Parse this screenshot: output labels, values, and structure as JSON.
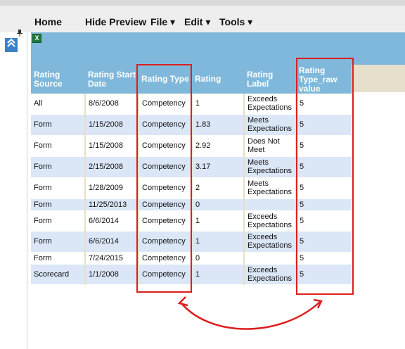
{
  "menubar": {
    "home": "Home",
    "hide_preview": "Hide Preview",
    "file": "File ▾",
    "edit": "Edit ▾",
    "tools": "Tools ▾"
  },
  "icons": {
    "collapse": "double-chevron-up-icon",
    "pin": "pin-icon",
    "excel": "excel-icon"
  },
  "colors": {
    "header_bg": "#7fb8da",
    "row_alt": "#dbe7f7",
    "annotation": "#dd1f1f"
  },
  "table": {
    "headers": [
      "Rating Source",
      "Rating Start Date",
      "Rating Type",
      "Rating",
      "Rating Label",
      "Rating Type_raw value"
    ],
    "rows": [
      [
        "All",
        "8/6/2008",
        "Competency",
        "1",
        "Exceeds Expectations",
        "5"
      ],
      [
        "Form",
        "1/15/2008",
        "Competency",
        "1.83",
        "Meets Expectations",
        "5"
      ],
      [
        "Form",
        "1/15/2008",
        "Competency",
        "2.92",
        "Does Not Meet",
        "5"
      ],
      [
        "Form",
        "2/15/2008",
        "Competency",
        "3.17",
        "Meets Expectations",
        "5"
      ],
      [
        "Form",
        "1/28/2009",
        "Competency",
        "2",
        "Meets Expectations",
        "5"
      ],
      [
        "Form",
        "11/25/2013",
        "Competency",
        "0",
        "",
        "5"
      ],
      [
        "Form",
        "6/6/2014",
        "Competency",
        "1",
        "Exceeds Expectations",
        "5"
      ],
      [
        "Form",
        "6/6/2014",
        "Competency",
        "1",
        "Exceeds Expectations",
        "5"
      ],
      [
        "Form",
        "7/24/2015",
        "Competency",
        "0",
        "",
        "5"
      ],
      [
        "Scorecard",
        "1/1/2008",
        "Competency",
        "1",
        "Exceeds Expectations",
        "5"
      ]
    ]
  }
}
